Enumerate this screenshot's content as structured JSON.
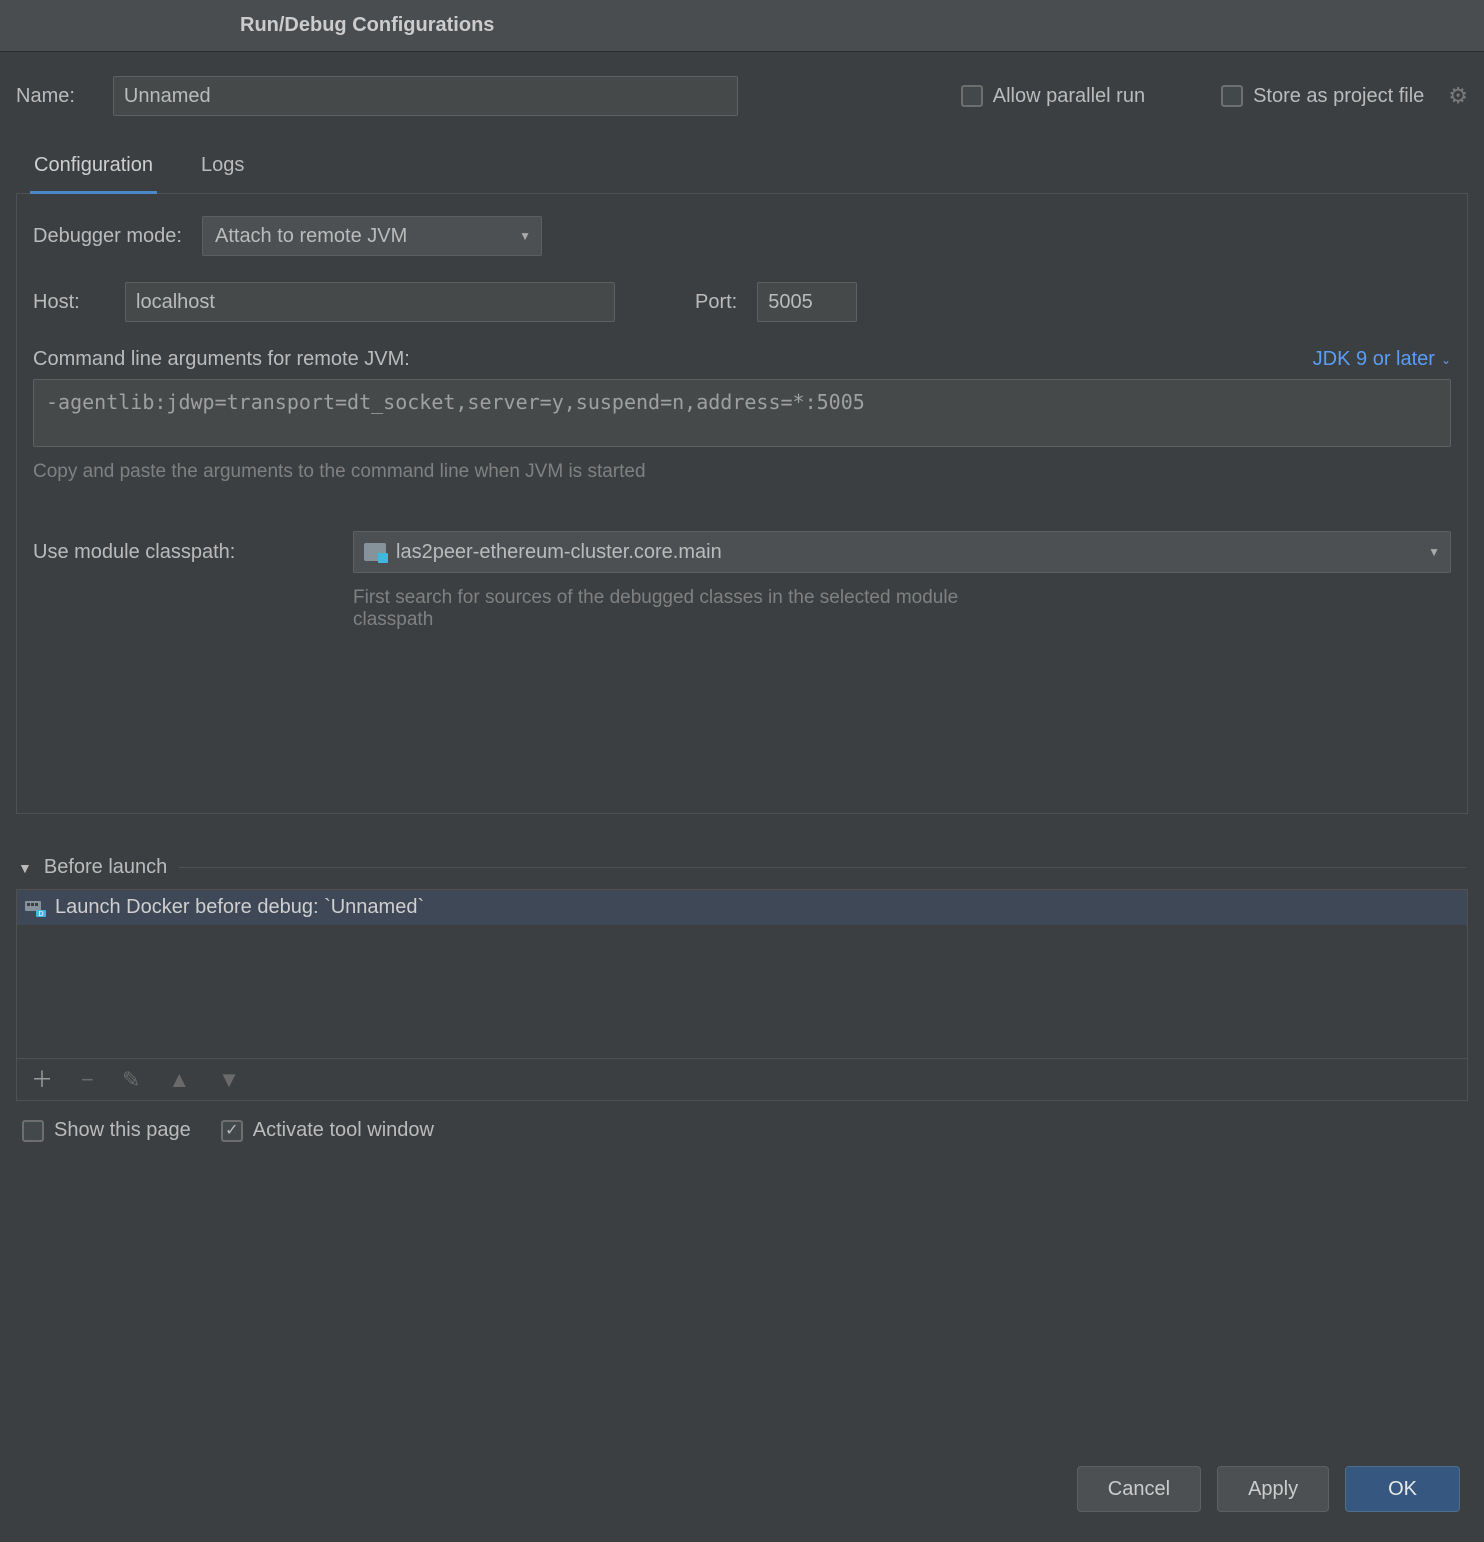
{
  "title": "Run/Debug Configurations",
  "nameLabel": "Name:",
  "nameValue": "Unnamed",
  "allowParallel": "Allow parallel run",
  "storeProject": "Store as project file",
  "tabs": {
    "configuration": "Configuration",
    "logs": "Logs"
  },
  "debuggerModeLabel": "Debugger mode:",
  "debuggerModeValue": "Attach to remote JVM",
  "hostLabel": "Host:",
  "hostValue": "localhost",
  "portLabel": "Port:",
  "portValue": "5005",
  "cmdArgsLabel": "Command line arguments for remote JVM:",
  "jdkLink": "JDK 9 or later",
  "cmdArgsValue": "-agentlib:jdwp=transport=dt_socket,server=y,suspend=n,address=*:5005",
  "cmdHint": "Copy and paste the arguments to the command line when JVM is started",
  "moduleLabel": "Use module classpath:",
  "moduleValue": "las2peer-ethereum-cluster.core.main",
  "moduleHint": "First search for sources of the debugged classes in the selected module classpath",
  "beforeLaunch": "Before launch",
  "launchItem": "Launch Docker before debug: `Unnamed`",
  "showPage": "Show this page",
  "activateWindow": "Activate tool window",
  "buttons": {
    "cancel": "Cancel",
    "apply": "Apply",
    "ok": "OK"
  }
}
